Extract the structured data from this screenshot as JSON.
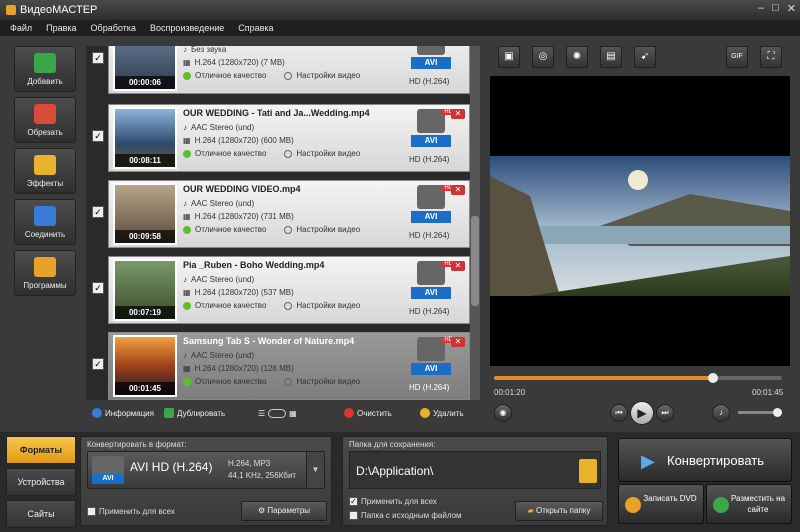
{
  "app": {
    "title": "ВидеоМАСТЕР"
  },
  "menu": [
    "Файл",
    "Правка",
    "Обработка",
    "Воспроизведение",
    "Справка"
  ],
  "sidebar": [
    {
      "label": "Добавить",
      "icon": "add-icon",
      "color": "#3aa84a"
    },
    {
      "label": "Обрезать",
      "icon": "scissors-icon",
      "color": "#d84a3a"
    },
    {
      "label": "Эффекты",
      "icon": "effects-icon",
      "color": "#e8b32a"
    },
    {
      "label": "Соединить",
      "icon": "join-icon",
      "color": "#3a7ad8"
    },
    {
      "label": "Программы",
      "icon": "programs-icon",
      "color": "#e8a22a"
    }
  ],
  "files": [
    {
      "name": "",
      "audio": "Без звука",
      "video": "H.264 (1280x720) (7 MB)",
      "quality": "Отличное качество",
      "settings": "Настройки видео",
      "format": "AVI",
      "format_label": "HD (H.264)",
      "time": "00:00:06",
      "checked": "✓",
      "selected": false
    },
    {
      "name": "OUR WEDDING - Tati and Ja...Wedding.mp4",
      "audio": "AAC Stereo (und)",
      "video": "H.264 (1280x720) (600 MB)",
      "quality": "Отличное качество",
      "settings": "Настройки видео",
      "format": "AVI",
      "format_label": "HD (H.264)",
      "time": "00:08:11",
      "checked": "✓",
      "selected": false
    },
    {
      "name": "OUR WEDDING VIDEO.mp4",
      "audio": "AAC Stereo (und)",
      "video": "H.264 (1280x720) (731 MB)",
      "quality": "Отличное качество",
      "settings": "Настройки видео",
      "format": "AVI",
      "format_label": "HD (H.264)",
      "time": "00:09:58",
      "checked": "✓",
      "selected": false
    },
    {
      "name": "Pia _Ruben - Boho Wedding.mp4",
      "audio": "AAC Stereo (und)",
      "video": "H.264 (1280x720) (537 MB)",
      "quality": "Отличное качество",
      "settings": "Настройки видео",
      "format": "AVI",
      "format_label": "HD (H.264)",
      "time": "00:07:19",
      "checked": "✓",
      "selected": false
    },
    {
      "name": "Samsung Tab S - Wonder of Nature.mp4",
      "audio": "AAC Stereo (und)",
      "video": "H.264 (1280x720) (128 MB)",
      "quality": "Отличное качество",
      "settings": "Настройки видео",
      "format": "AVI",
      "format_label": "HD (H.264)",
      "time": "00:01:45",
      "checked": "✓",
      "selected": true
    }
  ],
  "listbar": {
    "info": "Информация",
    "duplicate": "Дублировать",
    "clear": "Очистить",
    "delete": "Удалить"
  },
  "player": {
    "current": "00:01:20",
    "total": "00:01:45",
    "progress": 0.76,
    "volume": 1.0
  },
  "video_tools": [
    "crop-icon",
    "stabilize-icon",
    "brightness-icon",
    "effects-icon",
    "speed-icon",
    "gif-icon",
    "fullscreen-icon"
  ],
  "video_tools_labels": {
    "gif": "GIF"
  },
  "bottom": {
    "tabs": [
      "Форматы",
      "Устройства",
      "Сайты"
    ],
    "convert_label": "Конвертировать в формат:",
    "format_name": "AVI HD (H.264)",
    "format_badge": "AVI",
    "format_spec1": "H.264, MP3",
    "format_spec2": "44,1 KHz, 256Кбит",
    "apply_all": "Применить для всех",
    "params": "Параметры",
    "folder_label": "Папка для сохранения:",
    "folder_path": "D:\\Application\\",
    "folder_apply_all": "Применить для всех",
    "source_folder": "Папка с исходным файлом",
    "open_folder": "Открыть папку",
    "convert_btn": "Конвертировать",
    "dvd_btn": "Записать DVD",
    "web_btn": "Разместить на сайте"
  }
}
